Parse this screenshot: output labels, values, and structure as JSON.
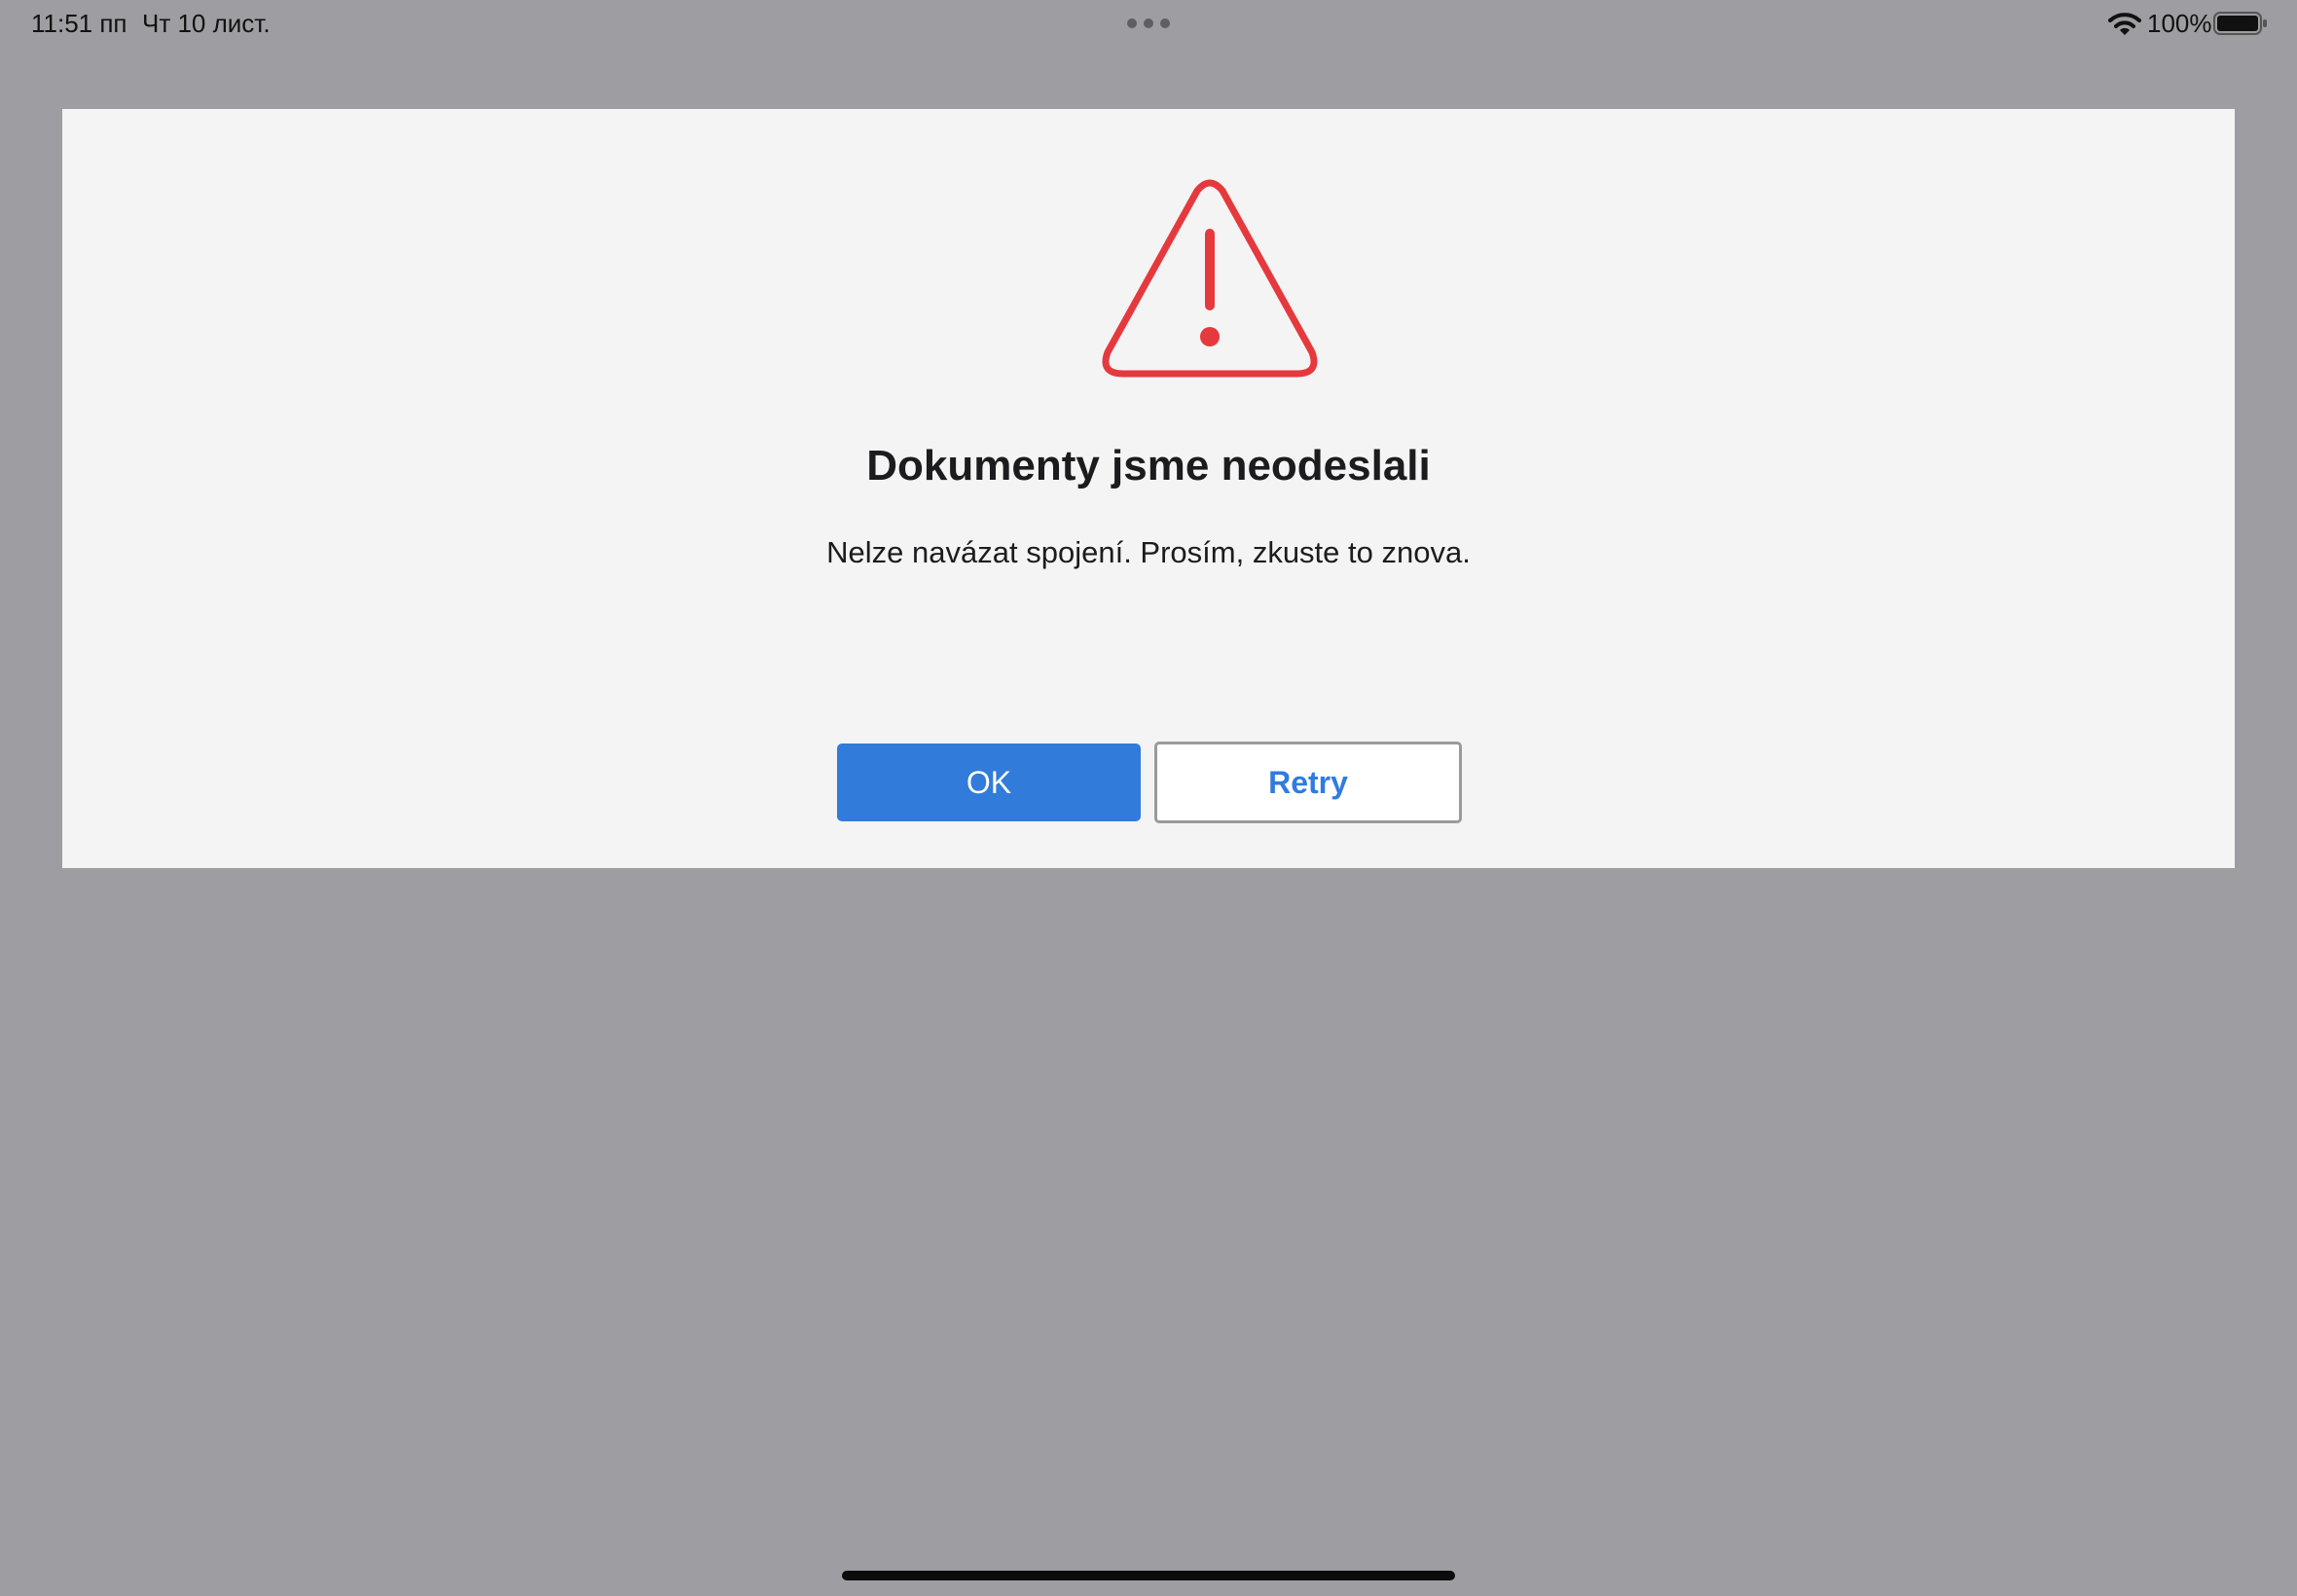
{
  "status_bar": {
    "time": "11:51 пп",
    "date": "Чт 10 лист.",
    "battery": "100%",
    "icons": [
      "multitask-dots-icon",
      "wifi-icon",
      "battery-icon"
    ]
  },
  "dialog": {
    "icon": "warning-triangle-icon",
    "icon_color": "#e5393e",
    "title": "Dokumenty jsme neodeslali",
    "message": "Nelze navázat spojení. Prosím, zkuste to znova.",
    "buttons": {
      "ok_label": "OK",
      "retry_label": "Retry"
    }
  },
  "colors": {
    "backdrop": "#9e9da2",
    "dialog_background": "#f4f4f4",
    "primary_button": "#317bdb",
    "retry_text": "#2f7be0"
  }
}
